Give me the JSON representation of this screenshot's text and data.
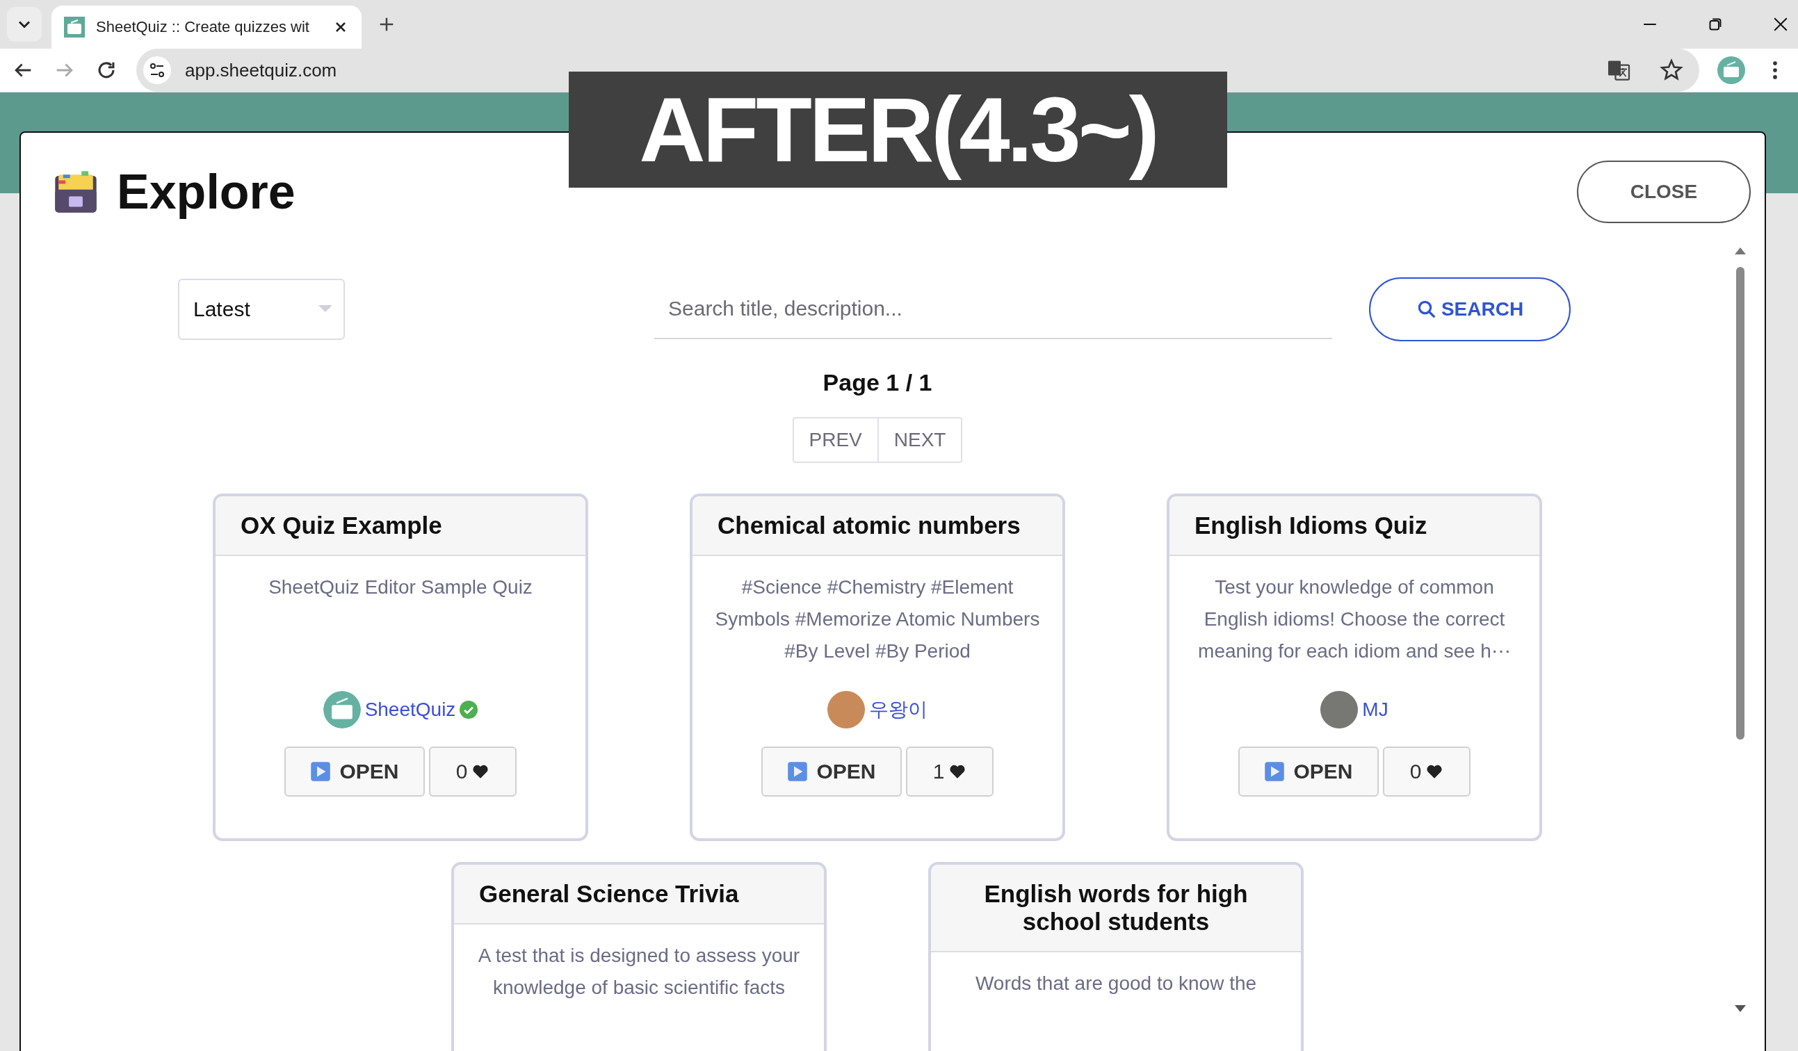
{
  "browser": {
    "tab_title": "SheetQuiz :: Create quizzes wit",
    "url": "app.sheetquiz.com"
  },
  "banner": {
    "text": "AFTER(4.3~)"
  },
  "modal": {
    "title": "Explore",
    "close": "CLOSE",
    "sort": "Latest",
    "search": {
      "placeholder": "Search title, description..."
    },
    "search_button": "SEARCH",
    "page": "Page 1 / 1",
    "prev": "PREV",
    "next": "NEXT",
    "cards": [
      {
        "title": "OX Quiz Example",
        "description": "SheetQuiz Editor Sample Quiz",
        "author": {
          "name": "SheetQuiz",
          "kind": "logo",
          "verified": true
        },
        "open": "OPEN",
        "likes": "0"
      },
      {
        "title": "Chemical atomic numbers",
        "description": "#Science #Chemistry #Element Symbols #Memorize Atomic Numbers #By Level #By Period",
        "author": {
          "name": "우왕이",
          "kind": "picture",
          "verified": false
        },
        "open": "OPEN",
        "likes": "1"
      },
      {
        "title": "English Idioms Quiz",
        "description": "Test your knowledge of common English idioms! Choose the correct meaning for each idiom and see h⋯",
        "author": {
          "name": "MJ",
          "kind": "plain",
          "verified": false
        },
        "open": "OPEN",
        "likes": "0"
      },
      {
        "title": "General Science Trivia",
        "description": "A test that is designed to assess your knowledge of basic scientific facts"
      },
      {
        "title": "English words for high school students",
        "description": "Words that are good to know the"
      }
    ]
  }
}
